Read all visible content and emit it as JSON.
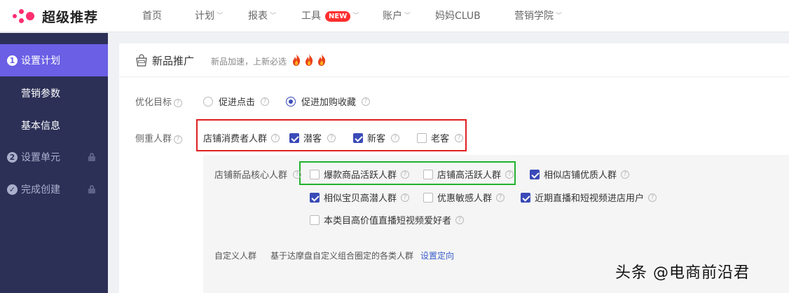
{
  "app": {
    "title": "超级推荐"
  },
  "nav": {
    "items": [
      {
        "label": "首页",
        "has_dropdown": false
      },
      {
        "label": "计划",
        "has_dropdown": true
      },
      {
        "label": "报表",
        "has_dropdown": true
      },
      {
        "label": "工具",
        "has_dropdown": true,
        "badge": "NEW"
      },
      {
        "label": "账户",
        "has_dropdown": true
      },
      {
        "label": "妈妈CLUB",
        "has_dropdown": false
      },
      {
        "label": "营销学院",
        "has_dropdown": true
      }
    ]
  },
  "sidebar": {
    "steps": [
      {
        "num": "1",
        "label": "设置计划",
        "active": true
      },
      {
        "num": "2",
        "label": "设置单元",
        "locked": true
      },
      {
        "label": "完成创建",
        "locked": true
      }
    ],
    "subitems": [
      {
        "label": "营销参数"
      },
      {
        "label": "基本信息"
      }
    ]
  },
  "card": {
    "title": "新品推广",
    "subtitle": "新品加速，上新必选"
  },
  "form": {
    "goal": {
      "label": "优化目标",
      "options": [
        {
          "label": "促进点击",
          "selected": false
        },
        {
          "label": "促进加购收藏",
          "selected": true
        }
      ]
    },
    "audience": {
      "label": "侧重人群",
      "store_group_label": "店铺消费者人群",
      "store_options": [
        {
          "label": "潜客",
          "checked": true
        },
        {
          "label": "新客",
          "checked": true
        },
        {
          "label": "老客",
          "checked": false
        }
      ],
      "core_label": "店铺新品核心人群",
      "core_options": [
        {
          "label": "爆款商品活跃人群",
          "checked": false
        },
        {
          "label": "店铺高活跃人群",
          "checked": false
        },
        {
          "label": "相似店铺优质人群",
          "checked": true
        },
        {
          "label": "相似宝贝高潜人群",
          "checked": true
        },
        {
          "label": "优惠敏感人群",
          "checked": false
        },
        {
          "label": "近期直播和短视频进店用户",
          "checked": true
        },
        {
          "label": "本类目高价值直播短视频爱好者",
          "checked": false
        }
      ],
      "custom_label": "自定义人群",
      "custom_desc": "基于达摩盘自定义组合圈定的各类人群",
      "custom_link": "设置定向"
    }
  },
  "watermark": "头条 @电商前沿君",
  "colors": {
    "brand_pink": "#ff2e6f",
    "sidebar_bg": "#2c3057",
    "active_step": "#6a5fe5",
    "check_blue": "#3a4ab8",
    "highlight_red": "#e02020",
    "highlight_green": "#22b22e"
  }
}
